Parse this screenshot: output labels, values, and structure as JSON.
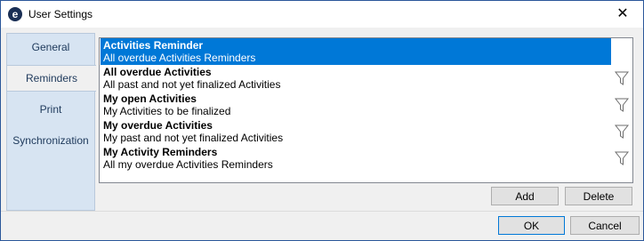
{
  "window": {
    "title": "User Settings",
    "app_icon_glyph": "e",
    "close_glyph": "✕"
  },
  "sidebar": {
    "items": [
      {
        "label": "General",
        "active": false
      },
      {
        "label": "Reminders",
        "active": true
      },
      {
        "label": "Print",
        "active": false
      },
      {
        "label": "Synchronization",
        "active": false
      }
    ]
  },
  "reminders": [
    {
      "title": "Activities Reminder",
      "subtitle": "All overdue Activities Reminders",
      "selected": true
    },
    {
      "title": "All overdue Activities",
      "subtitle": "All past and not yet finalized Activities",
      "selected": false
    },
    {
      "title": "My open Activities",
      "subtitle": "My Activities to be finalized",
      "selected": false
    },
    {
      "title": "My overdue Activities",
      "subtitle": "My past and not yet finalized Activities",
      "selected": false
    },
    {
      "title": "My Activity Reminders",
      "subtitle": "All my overdue Activities Reminders",
      "selected": false
    }
  ],
  "actions": {
    "add_label": "Add",
    "delete_label": "Delete"
  },
  "footer": {
    "ok_label": "OK",
    "cancel_label": "Cancel"
  },
  "colors": {
    "selection": "#0078d7",
    "sidebar_bg": "#d7e4f2",
    "window_border": "#2b579a"
  },
  "icons": {
    "row_action": "filter-icon",
    "close": "close-icon",
    "app": "app-logo-icon"
  }
}
